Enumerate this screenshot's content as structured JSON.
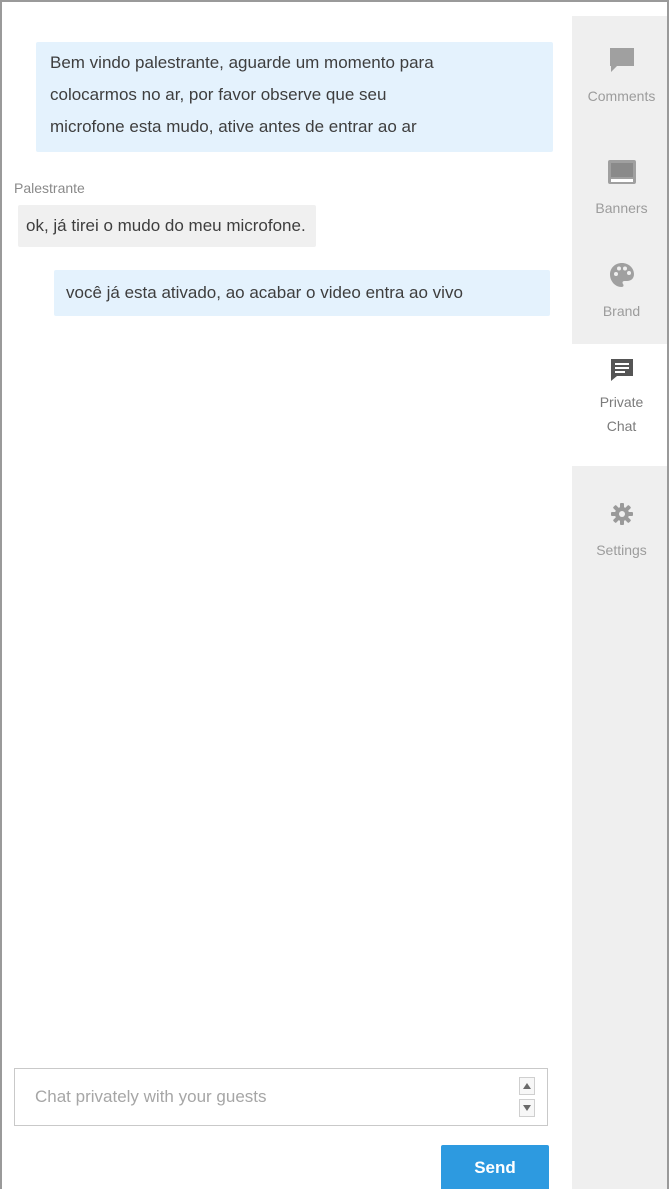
{
  "chat": {
    "messages": [
      {
        "from": "self",
        "lines": [
          "Bem vindo palestrante, aguarde um momento para",
          "colocarmos no ar, por favor observe que seu",
          "microfone esta mudo, ative antes de entrar ao ar"
        ]
      },
      {
        "from": "guest",
        "sender": "Palestrante",
        "text": "ok, já tirei o mudo do meu microfone."
      },
      {
        "from": "self",
        "text": "você já esta ativado, ao acabar o video entra ao vivo"
      }
    ],
    "input": {
      "placeholder": "Chat privately with your guests",
      "value": ""
    },
    "send_label": "Send"
  },
  "sidebar": {
    "items": [
      {
        "label": "Comments",
        "icon": "comment-icon",
        "active": false
      },
      {
        "label": "Banners",
        "icon": "banner-icon",
        "active": false
      },
      {
        "label": "Brand",
        "icon": "palette-icon",
        "active": false
      },
      {
        "label": "Private Chat",
        "icon": "private-chat-icon",
        "active": true
      },
      {
        "label": "Settings",
        "icon": "gear-icon",
        "active": false
      }
    ]
  },
  "colors": {
    "own_bubble": "#e4f2fd",
    "guest_bubble": "#f0f0f0",
    "send_button": "#2d9ae0",
    "sidebar_bg": "#efefef",
    "sidebar_icon": "#9c9c9c"
  }
}
